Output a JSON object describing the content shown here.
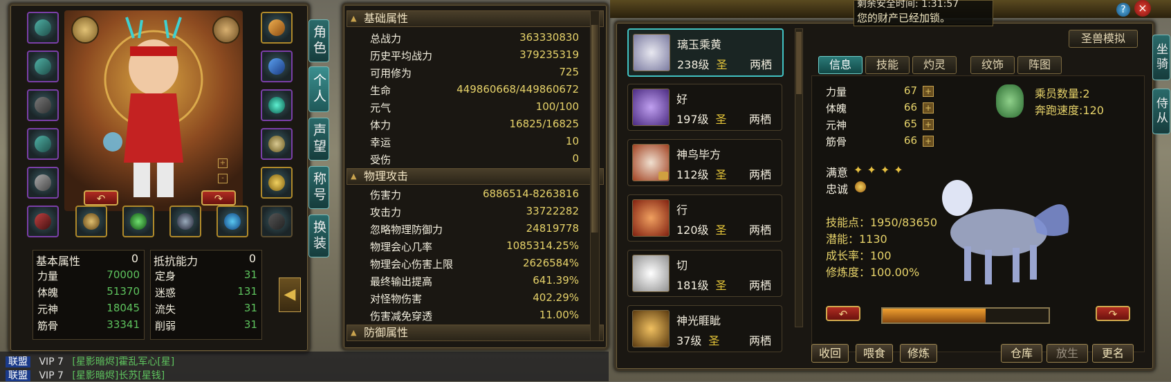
{
  "left_tabs": [
    "角色",
    "个人",
    "声望",
    "称号",
    "换装"
  ],
  "base_attr": {
    "title": "基本属性",
    "title_val": "0",
    "rows": [
      {
        "k": "力量",
        "v": "70000"
      },
      {
        "k": "体魄",
        "v": "51370"
      },
      {
        "k": "元神",
        "v": "18045"
      },
      {
        "k": "筋骨",
        "v": "33341"
      }
    ]
  },
  "resist": {
    "title": "抵抗能力",
    "title_val": "0",
    "rows": [
      {
        "k": "定身",
        "v": "31"
      },
      {
        "k": "迷惑",
        "v": "131"
      },
      {
        "k": "流失",
        "v": "31"
      },
      {
        "k": "削弱",
        "v": "31"
      }
    ]
  },
  "stats": {
    "basic_title": "基础属性",
    "basic": [
      {
        "k": "总战力",
        "v": "363330830"
      },
      {
        "k": "历史平均战力",
        "v": "379235319"
      },
      {
        "k": "可用修为",
        "v": "725"
      },
      {
        "k": "生命",
        "v": "449860668/449860672"
      },
      {
        "k": "元气",
        "v": "100/100"
      },
      {
        "k": "体力",
        "v": "16825/16825"
      },
      {
        "k": "幸运",
        "v": "10"
      },
      {
        "k": "受伤",
        "v": "0"
      }
    ],
    "phys_title": "物理攻击",
    "phys": [
      {
        "k": "伤害力",
        "v": "6886514-8263816"
      },
      {
        "k": "攻击力",
        "v": "33722282"
      },
      {
        "k": "忽略物理防御力",
        "v": "24819778"
      },
      {
        "k": "物理会心几率",
        "v": "1085314.25%"
      },
      {
        "k": "物理会心伤害上限",
        "v": "2626584%"
      },
      {
        "k": "最终输出提高",
        "v": "641.39%"
      },
      {
        "k": "对怪物伤害",
        "v": "402.29%"
      },
      {
        "k": "伤害减免穿透",
        "v": "11.00%"
      }
    ],
    "def_title": "防御属性"
  },
  "pets": [
    {
      "name": "璃玉乘黄",
      "level": "238级",
      "rank": "圣",
      "type": "两栖"
    },
    {
      "name": "好",
      "level": "197级",
      "rank": "圣",
      "type": "两栖"
    },
    {
      "name": "神鸟毕方",
      "level": "112级",
      "rank": "圣",
      "type": "两栖"
    },
    {
      "name": "行",
      "level": "120级",
      "rank": "圣",
      "type": "两栖"
    },
    {
      "name": "切",
      "level": "181级",
      "rank": "圣",
      "type": "两栖"
    },
    {
      "name": "神光睚眦",
      "level": "37级",
      "rank": "圣",
      "type": "两栖"
    }
  ],
  "pet_tabs": [
    "信息",
    "技能",
    "灼灵",
    "纹饰",
    "阵图"
  ],
  "simulate_label": "圣兽模拟",
  "pet_info": {
    "attrs": [
      {
        "k": "力量",
        "v": "67"
      },
      {
        "k": "体魄",
        "v": "66"
      },
      {
        "k": "元神",
        "v": "65"
      },
      {
        "k": "筋骨",
        "v": "66"
      }
    ],
    "crew": "乘员数量:2",
    "speed": "奔跑速度:120",
    "satisfaction_label": "满意",
    "loyalty_label": "忠诚",
    "skill_points": "技能点：1950/83650",
    "potential": "潜能：1130",
    "growth": "成长率：100",
    "cultivation": "修炼度：100.00%",
    "progress": 0.62
  },
  "pet_buttons_left": [
    "收回",
    "喂食",
    "修炼"
  ],
  "pet_buttons_right": [
    "仓库",
    "放生",
    "更名"
  ],
  "notice": {
    "line1": "剩余安全时间:  1:31:57",
    "line2": "您的财产已经加锁。"
  },
  "right_tabs": [
    "坐骑",
    "侍从"
  ],
  "chat": [
    {
      "channel": "联盟",
      "vip": "VIP 7",
      "text": "[星影暗烬]霍乱军心[星]"
    },
    {
      "channel": "联盟",
      "vip": "VIP 7",
      "text": "[星影暗烬]长苏[星钱]"
    }
  ],
  "colors": {
    "gold": "#e7d36a",
    "teal": "#41c3c3",
    "green": "#5ec45e"
  }
}
